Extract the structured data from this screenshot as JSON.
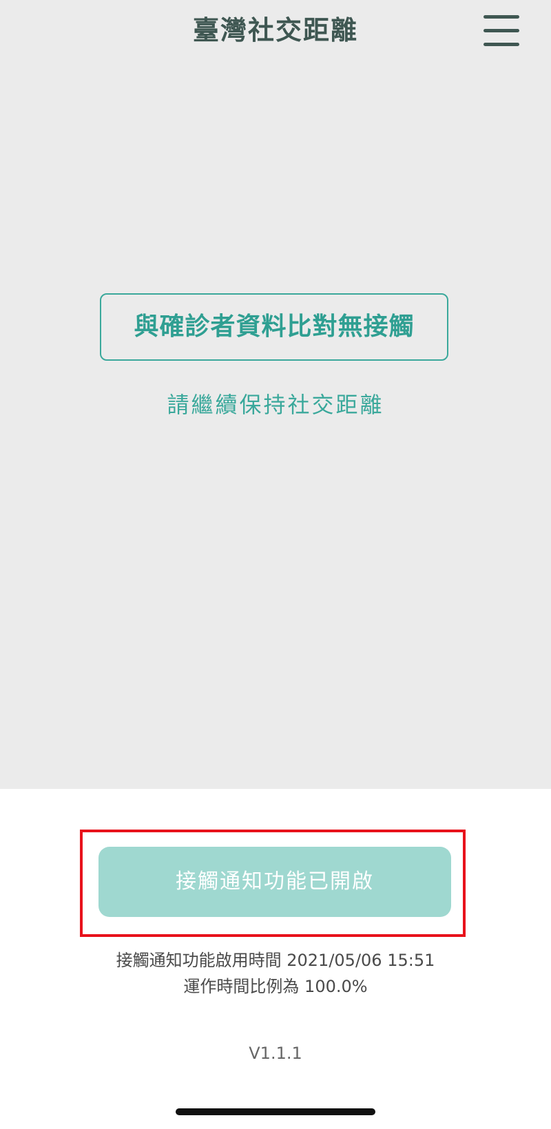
{
  "header": {
    "title": "臺灣社交距離",
    "menu_icon": "hamburger-menu-icon"
  },
  "status": {
    "result_text": "與確診者資料比對無接觸",
    "advice_text": "請繼續保持社交距離"
  },
  "notification": {
    "button_label": "接觸通知功能已開啟",
    "enabled_time_line": "接觸通知功能啟用時間 2021/05/06 15:51",
    "uptime_line": "運作時間比例為 100.0%"
  },
  "footer": {
    "version": "V1.1.1"
  },
  "colors": {
    "accent": "#3aa89b",
    "header_text": "#3f5752",
    "button_bg": "#9fd8d0",
    "highlight": "#e8121b",
    "panel_bg": "#ebebeb"
  }
}
